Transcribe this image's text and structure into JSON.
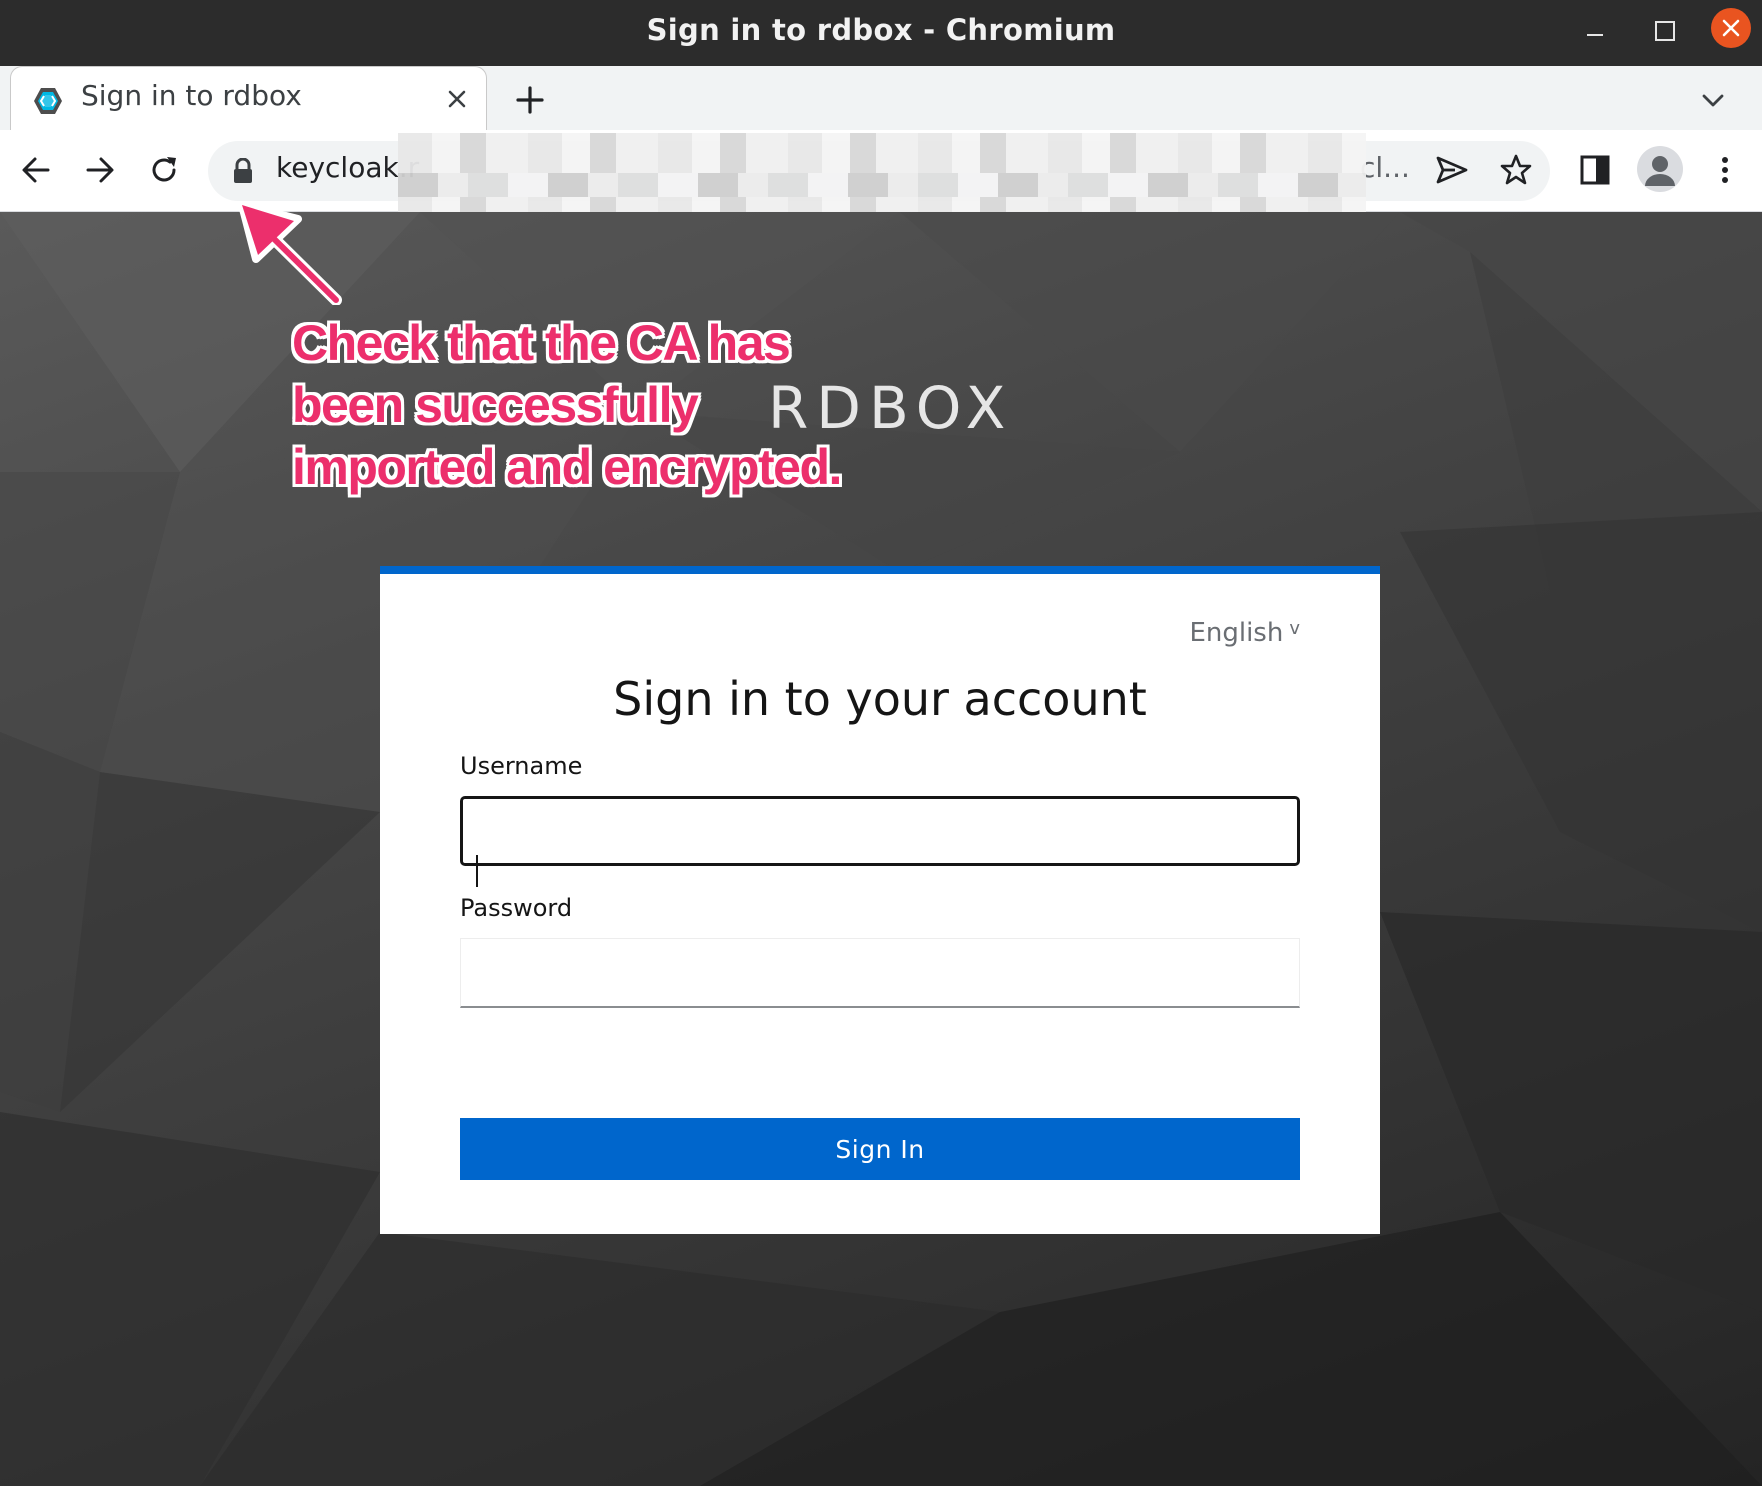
{
  "window": {
    "title": "Sign in to rdbox - Chromium"
  },
  "tab": {
    "title": "Sign in to rdbox",
    "favicon": "keycloak-icon"
  },
  "toolbar": {
    "url_prefix": "keycloak.r",
    "url_suffix": "cl...",
    "icons": [
      "back-icon",
      "forward-icon",
      "reload-icon",
      "lock-icon",
      "send-icon",
      "star-icon",
      "side-panel-icon",
      "profile-icon",
      "menu-icon"
    ]
  },
  "annotation": {
    "lines": [
      "Check that the CA has",
      "been successfully",
      "imported and encrypted."
    ],
    "color": "#ec2f6c"
  },
  "brand": {
    "name": "RDBOX"
  },
  "login": {
    "language": "English",
    "heading": "Sign in to your account",
    "username_label": "Username",
    "username_value": "",
    "password_label": "Password",
    "password_value": "",
    "submit_label": "Sign In",
    "accent_color": "#0066cc"
  }
}
